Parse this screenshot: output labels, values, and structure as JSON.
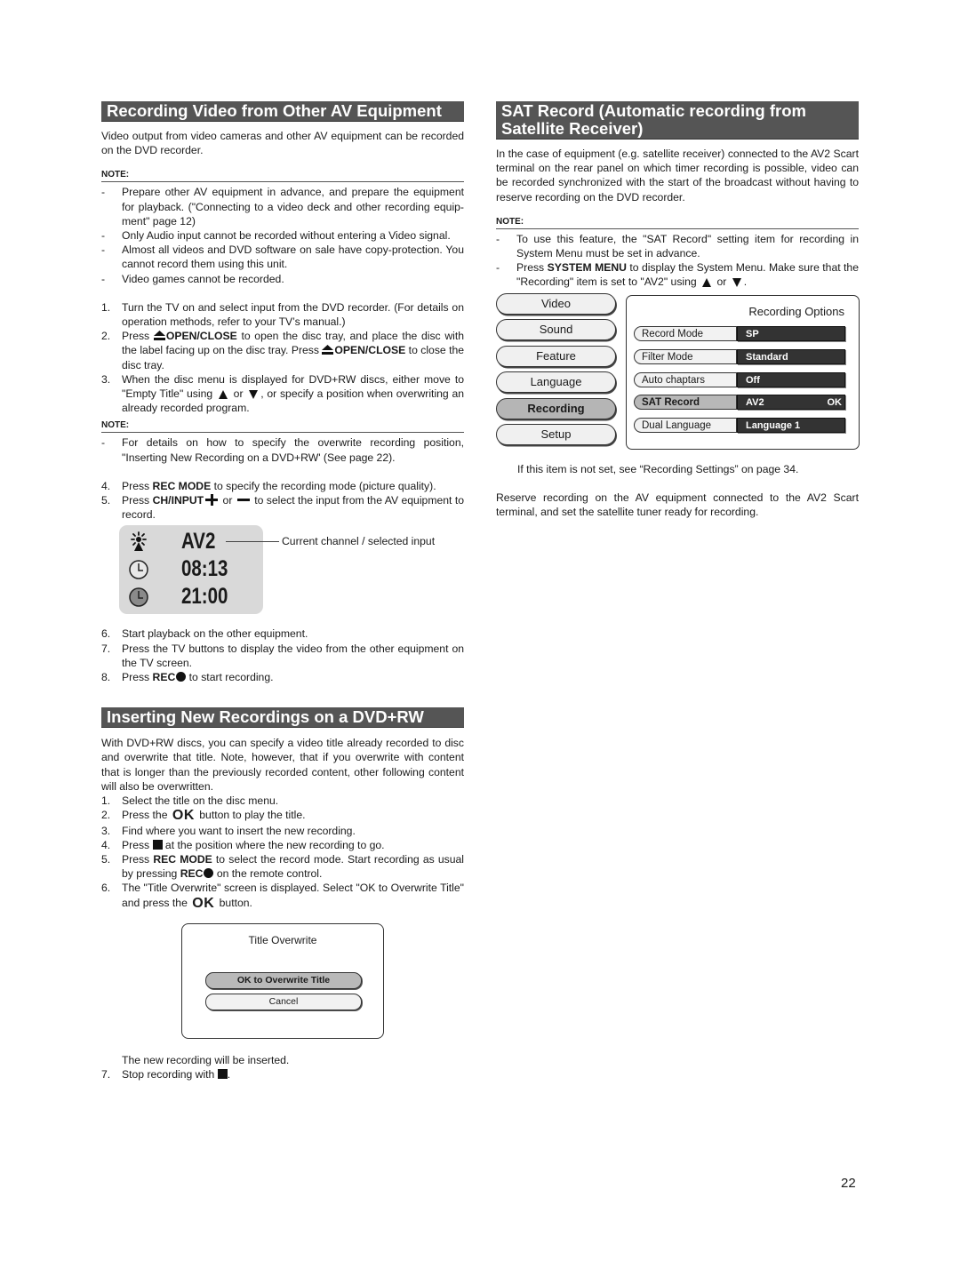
{
  "left": {
    "section1": {
      "title": "Recording Video from Other AV Equipment",
      "intro": "Video output from video cameras and other AV equipment can be recorded on the DVD recorder.",
      "note_label": "NOTE:",
      "notes": [
        "Prepare other AV equipment in advance, and prepare the equipment for playback. (\"Connecting to a video deck and other recording equip-ment\" page 12)",
        "Only Audio input cannot be recorded without entering a Video signal.",
        " Almost all videos and DVD software on sale have copy-protection. You cannot record them using this unit.",
        "Video games cannot be recorded."
      ],
      "steps_a": [
        {
          "num": "1.",
          "text": "Turn the TV on and select input from the DVD recorder. (For details on operation methods, refer to your TV’s manual.)"
        },
        {
          "num": "2.",
          "pre": "Press ",
          "key1": "OPEN/CLOSE",
          "mid": " to open the disc tray, and place the disc with the label facing up on the disc tray. Press ",
          "key2": "OPEN/CLOSE",
          "post": " to close the disc tray."
        },
        {
          "num": "3.",
          "pre": "When the disc menu is displayed for DVD+RW discs, either move to \"Empty Title\" using ",
          "or": " or ",
          "post": ", or specify a position when overwriting an already recorded program."
        }
      ],
      "note2_label": "NOTE:",
      "notes2": [
        "For details on how to specify the overwrite recording position, \"Inserting New Recording on a DVD+RW' (See page 22)."
      ],
      "steps_b": [
        {
          "num": "4.",
          "pre": "Press ",
          "key": "REC MODE",
          "post": " to specify the recording mode (picture quality)."
        },
        {
          "num": "5.",
          "pre": "Press ",
          "key": "CH/INPUT",
          "or": " or ",
          "post": " to select the input from the AV equipment to record."
        }
      ],
      "osd": {
        "channel": "AV2",
        "time1": "08:13",
        "time2": "21:00",
        "callout": "Current channel / selected input",
        "icons": [
          "antenna-icon",
          "clock-icon",
          "clock-filled-icon"
        ]
      },
      "steps_c": [
        {
          "num": "6.",
          "text": "Start playback on the other equipment."
        },
        {
          "num": "7.",
          "text": "Press the TV buttons to display the video from the other equipment on the TV screen."
        },
        {
          "num": "8.",
          "pre": "Press ",
          "key": "REC",
          "post": " to start recording."
        }
      ]
    },
    "section2": {
      "title": "Inserting New Recordings on a DVD+RW",
      "intro": "With DVD+RW discs, you can specify a video title already recorded to disc and overwrite that title. Note, however, that if you overwrite with content that is longer than the previously recorded content, other following content will also be overwritten.",
      "steps": [
        {
          "num": "1.",
          "text": "Select the title on the disc menu."
        },
        {
          "num": "2.",
          "pre": "Press the ",
          "ok": "OK",
          "post": " button to play the title."
        },
        {
          "num": "3.",
          "text": "Find where you want to insert the new recording."
        },
        {
          "num": "4.",
          "pre": "Press ",
          "post": " at the position where the new recording to go."
        },
        {
          "num": "5.",
          "pre": "Press ",
          "key": "REC MODE",
          "mid": " to select the record mode. Start recording as usual by pressing ",
          "key2": "REC",
          "post": " on the remote control."
        },
        {
          "num": "6.",
          "pre": "The \"Title Overwrite\" screen is displayed. Select \"OK to Overwrite Title\" and press the ",
          "ok": "OK",
          "post": " button."
        }
      ],
      "dialog": {
        "title": "Title Overwrite",
        "primary": "OK to Overwrite Title",
        "secondary": "Cancel"
      },
      "after_dialog": "The new recording will be inserted.",
      "step7": {
        "num": "7.",
        "pre": "Stop recording with ",
        "post": "."
      }
    }
  },
  "right": {
    "title_line1": "SAT Record (Automatic recording from",
    "title_line2": "Satellite Receiver)",
    "intro": "In the case of equipment (e.g. satellite receiver) connected to the AV2 Scart terminal on the rear panel on which timer recording is possible, video can be recorded synchronized with the start of the broadcast without having to reserve recording on the DVD recorder.",
    "note_label": "NOTE:",
    "notes": [
      {
        "text": "To use this feature, the \"SAT Record\" setting item for recording in System Menu must be set in advance."
      },
      {
        "pre": "Press ",
        "key": "SYSTEM MENU",
        "mid": " to display the System Menu. Make sure that the \"Recording\" item is set to \"AV2\" using ",
        "or": " or ",
        "post": "."
      }
    ],
    "system_menu": {
      "categories": [
        "Video",
        "Sound",
        "Feature",
        "Language",
        "Recording",
        "Setup"
      ],
      "active_category": "Recording",
      "panel_title": "Recording Options",
      "options": [
        {
          "label": "Record Mode",
          "value": "SP",
          "ok": ""
        },
        {
          "label": "Filter Mode",
          "value": "Standard",
          "ok": ""
        },
        {
          "label": "Auto chaptars",
          "value": "Off",
          "ok": ""
        },
        {
          "label": "SAT Record",
          "value": "AV2",
          "ok": "OK"
        },
        {
          "label": "Dual Language",
          "value": "Language 1",
          "ok": ""
        }
      ],
      "active_option": "SAT Record"
    },
    "if_not_set": "If this item is not set, see “Recording Settings” on page 34.",
    "closing": "Reserve recording on the AV equipment connected to the AV2 Scart terminal, and set the satellite tuner ready for recording."
  },
  "page_number": "22"
}
